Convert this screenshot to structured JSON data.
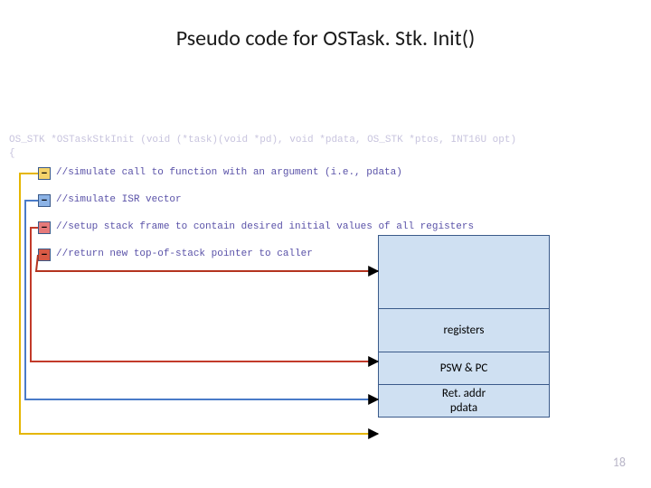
{
  "title": "Pseudo code for OSTask. Stk. Init()",
  "code_signature": "OS_STK *OSTaskStkInit (void (*task)(void *pd), void *pdata, OS_STK *ptos, INT16U opt)\n{",
  "comments": {
    "c1": "//simulate call to function with an argument (i.e., pdata)",
    "c2": "//simulate ISR vector",
    "c3": "//setup stack frame to contain desired initial values of all registers",
    "c4": "//return new top-of-stack pointer to caller"
  },
  "stack": {
    "top_blank": "",
    "registers": "registers",
    "psw_pc": "PSW & PC",
    "ret_pdata_line1": "Ret. addr",
    "ret_pdata_line2": "pdata"
  },
  "page_number": "18",
  "chart_data": {
    "type": "diagram",
    "title": "Pseudo code for OSTask.Stk.Init()",
    "code_steps": [
      {
        "index": 1,
        "color": "#f5d36a",
        "comment": "simulate call to function with an argument (i.e., pdata)",
        "points_to": "Ret. addr / pdata"
      },
      {
        "index": 2,
        "color": "#8cb3e6",
        "comment": "simulate ISR vector",
        "points_to": "PSW & PC"
      },
      {
        "index": 3,
        "color": "#e67a7a",
        "comment": "setup stack frame to contain desired initial values of all registers",
        "points_to": "registers"
      },
      {
        "index": 4,
        "color": "#d95a45",
        "comment": "return new top-of-stack pointer to caller",
        "points_to": "top-of-stack (blank cell)"
      }
    ],
    "stack_layout_top_to_bottom": [
      "(blank / top-of-stack)",
      "registers",
      "PSW & PC",
      "Ret. addr / pdata"
    ],
    "function_signature": "OS_STK *OSTaskStkInit(void (*task)(void *pd), void *pdata, OS_STK *ptos, INT16U opt)"
  }
}
